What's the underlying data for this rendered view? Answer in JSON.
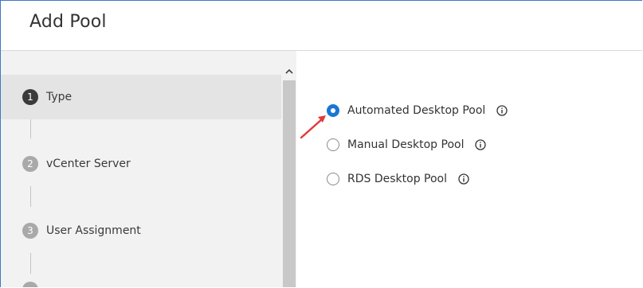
{
  "dialog": {
    "title": "Add Pool"
  },
  "steps": [
    {
      "number": "1",
      "label": "Type",
      "active": true
    },
    {
      "number": "2",
      "label": "vCenter Server",
      "active": false
    },
    {
      "number": "3",
      "label": "User Assignment",
      "active": false
    }
  ],
  "pool_type_options": [
    {
      "label": "Automated Desktop Pool",
      "selected": true
    },
    {
      "label": "Manual Desktop Pool",
      "selected": false
    },
    {
      "label": "RDS Desktop Pool",
      "selected": false
    }
  ],
  "icons": {
    "info": "info-icon",
    "scroll_up": "chevron-up-icon",
    "annotation": "red-arrow-icon"
  },
  "colors": {
    "accent": "#1a76d2",
    "annotation_arrow": "#e03a3a",
    "active_step": "#3b3b3b",
    "inactive_step": "#a9a9a9"
  }
}
